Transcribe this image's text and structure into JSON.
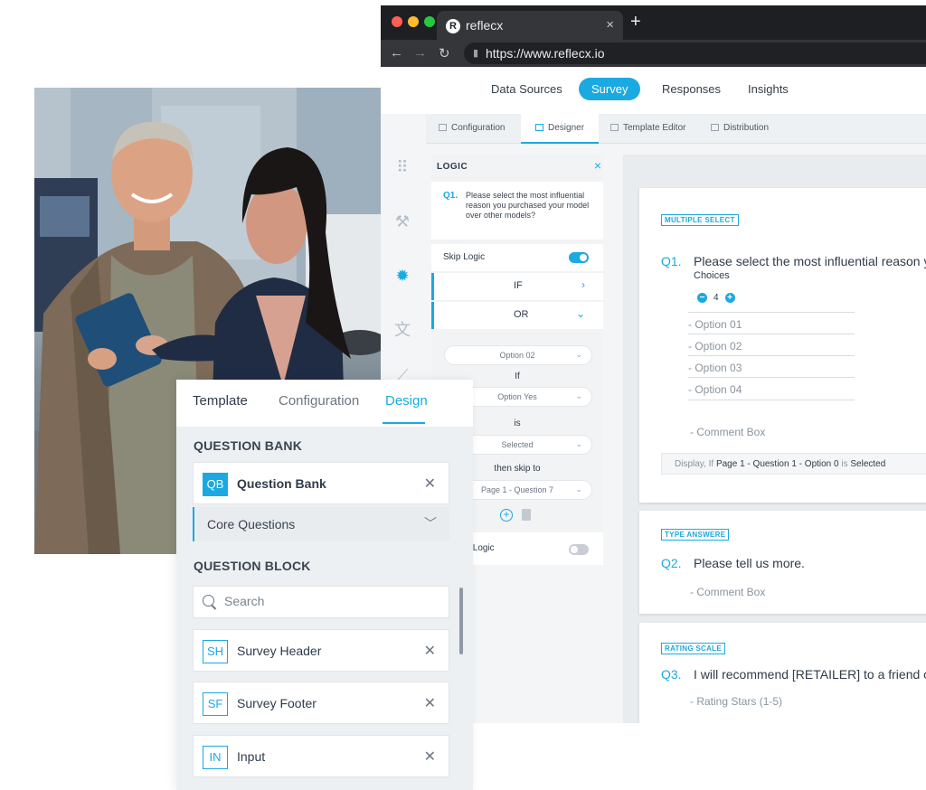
{
  "browser": {
    "tab_favicon": "R",
    "tab_title": "reflecx",
    "tab_close": "×",
    "new_tab": "+",
    "url": "https://www.reflecx.io"
  },
  "topnav": {
    "items": [
      "Data Sources",
      "Survey",
      "Responses",
      "Insights"
    ],
    "active": "Survey"
  },
  "subtabs": [
    "Configuration",
    "Designer",
    "Template Editor",
    "Distribution"
  ],
  "logic": {
    "title": "LOGIC",
    "close": "×",
    "question_number": "Q1.",
    "question_text": "Please select the most influential reason you purchased your model over other models?",
    "skip_logic_label": "Skip Logic",
    "if_label": "IF",
    "or_label": "OR",
    "option_select": "Option 02",
    "if_text": "If",
    "answer_select": "Option Yes",
    "is_text": "is",
    "state_select": "Selected",
    "then_text": "then skip to",
    "target_select": "Page 1 - Question 7",
    "bottom_label": "y Logic"
  },
  "canvas": {
    "q1": {
      "type": "MULTIPLE SELECT",
      "number": "Q1.",
      "text": "Please select the most influential reason you purchased your model over other models?",
      "choices_label": "Choices",
      "choice_count": "4",
      "options": [
        "- Option 01",
        "- Option 02",
        "- Option 03",
        "- Option 04"
      ],
      "comment": "- Comment Box",
      "display_prefix": "Display, If",
      "display_target": "Page 1 - Question 1 - Option 0",
      "display_is": "is",
      "display_state": "Selected"
    },
    "q2": {
      "type": "TYPE ANSWERE",
      "number": "Q2.",
      "text": "Please tell us more.",
      "comment": "- Comment Box"
    },
    "q3": {
      "type": "RATING SCALE",
      "number": "Q3.",
      "text": "I will recommend [RETAILER] to a friend or colleague.",
      "rating": "- Rating Stars (1-5)"
    }
  },
  "design_panel": {
    "tabs": [
      "Template",
      "Configuration",
      "Design"
    ],
    "active_tab": "Design",
    "question_bank_heading": "QUESTION BANK",
    "question_bank_item": {
      "badge": "QB",
      "label": "Question Bank"
    },
    "core_questions": "Core Questions",
    "question_block_heading": "QUESTION BLOCK",
    "search_placeholder": "Search",
    "blocks": [
      {
        "badge": "SH",
        "label": "Survey Header"
      },
      {
        "badge": "SF",
        "label": "Survey Footer"
      },
      {
        "badge": "IN",
        "label": "Input"
      }
    ]
  },
  "colors": {
    "accent": "#1ba9e1",
    "chrome_dark": "#1e1f22",
    "panel_bg": "#edf0f3"
  },
  "icons": {
    "rail": [
      "grid-icon",
      "wrench-icon",
      "lightbulb-icon",
      "translate-icon",
      "brush-icon"
    ]
  }
}
